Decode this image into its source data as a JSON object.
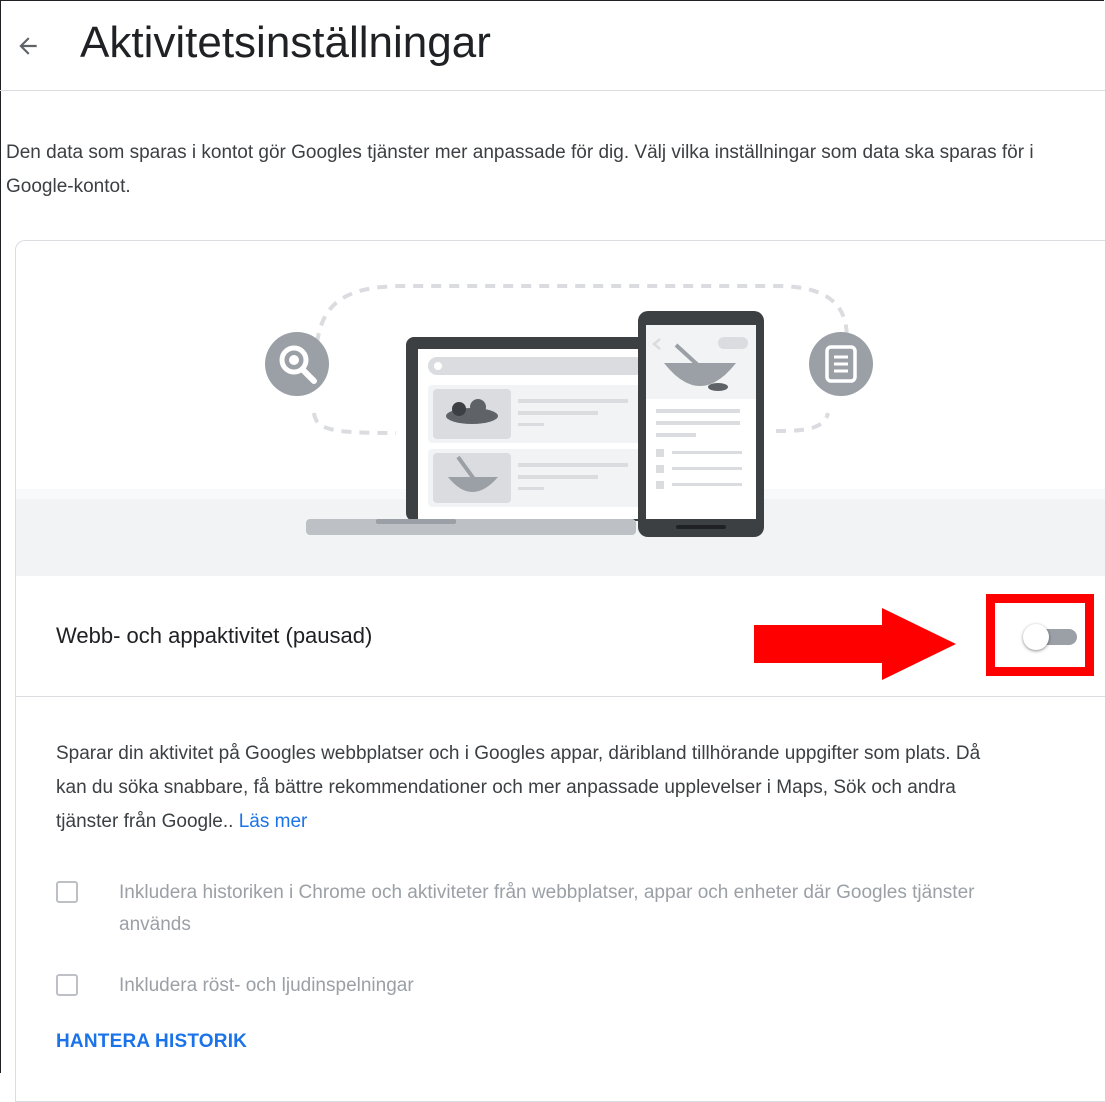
{
  "header": {
    "title": "Aktivitetsinställningar",
    "back_icon": "arrow-back-icon"
  },
  "intro": "Den data som sparas i kontot gör Googles tjänster mer anpassade för dig. Välj vilka inställningar som data ska sparas för i Google-kontot.",
  "activity": {
    "label": "Webb- och appaktivitet (pausad)",
    "toggle_on": false,
    "annotation_color": "#ff0000",
    "description": "Sparar din aktivitet på Googles webbplatser och i Googles appar, däribland tillhörande uppgifter som plats. Då kan du söka snabbare, få bättre rekommendationer och mer anpassade upplevelser i Maps, Sök och andra tjänster från Google..",
    "learn_more": "Läs mer",
    "options": [
      {
        "label": "Inkludera historiken i Chrome och aktiviteter från webbplatser, appar och enheter där Googles tjänster används",
        "checked": false
      },
      {
        "label": "Inkludera röst- och ljudinspelningar",
        "checked": false
      }
    ],
    "manage_history": "HANTERA HISTORIK"
  },
  "colors": {
    "accent": "#1a73e8",
    "disabled_text": "#9aa0a6",
    "toggle_off_track": "#9aa0a6"
  }
}
